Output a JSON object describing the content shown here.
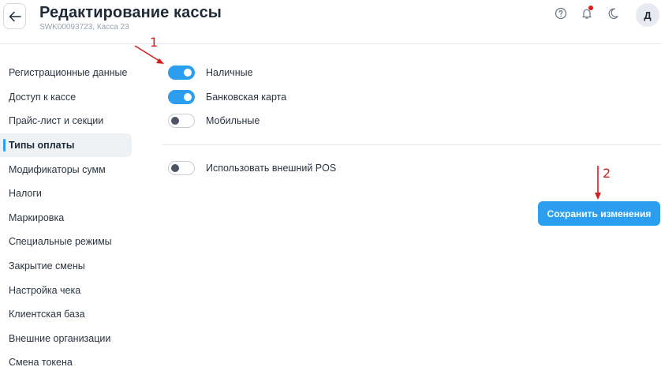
{
  "header": {
    "title": "Редактирование кассы",
    "subtitle": "SWK00093723, Касса 23",
    "avatar_initial": "Д"
  },
  "icons": {
    "back": "arrow-left-icon",
    "help": "question-circle-icon",
    "notifications": "bell-icon",
    "theme": "moon-icon"
  },
  "sidebar": {
    "items": [
      {
        "label": "Регистрационные данные",
        "active": false
      },
      {
        "label": "Доступ к кассе",
        "active": false
      },
      {
        "label": "Прайс-лист и секции",
        "active": false
      },
      {
        "label": "Типы оплаты",
        "active": true
      },
      {
        "label": "Модификаторы сумм",
        "active": false
      },
      {
        "label": "Налоги",
        "active": false
      },
      {
        "label": "Маркировка",
        "active": false
      },
      {
        "label": "Специальные режимы",
        "active": false
      },
      {
        "label": "Закрытие смены",
        "active": false
      },
      {
        "label": "Настройка чека",
        "active": false
      },
      {
        "label": "Клиентская база",
        "active": false
      },
      {
        "label": "Внешние организации",
        "active": false
      },
      {
        "label": "Смена токена",
        "active": false
      }
    ]
  },
  "payment_types": [
    {
      "label": "Наличные",
      "enabled": true
    },
    {
      "label": "Банковская карта",
      "enabled": true
    },
    {
      "label": "Мобильные",
      "enabled": false
    }
  ],
  "external_pos": {
    "label": "Использовать внешний POS",
    "enabled": false
  },
  "actions": {
    "save_label": "Сохранить изменения"
  },
  "annotations": {
    "first": "1",
    "second": "2"
  },
  "colors": {
    "accent": "#2b9ef0",
    "annotation": "#d11f1f",
    "notification_dot": "#e21b1b",
    "text": "#1f2a37",
    "muted": "#9aa3ad"
  }
}
